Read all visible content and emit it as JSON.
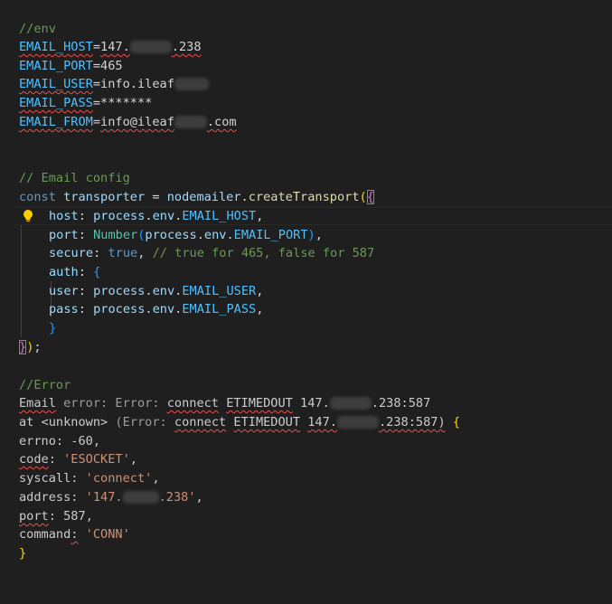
{
  "env_block": {
    "comment": "//env",
    "host_key": "EMAIL_HOST",
    "host_prefix": "147.",
    "host_suffix": ".238",
    "port_key": "EMAIL_PORT",
    "port_value": "465",
    "user_key": "EMAIL_USER",
    "user_value": "info.ileaf",
    "pass_key": "EMAIL_PASS",
    "pass_value": "*******",
    "from_key": "EMAIL_FROM",
    "from_prefix": "info@ileaf",
    "from_suffix": ".com"
  },
  "config_block": {
    "comment": "// Email config",
    "const_kw": "const",
    "transporter": "transporter",
    "nodemailer": "nodemailer",
    "create_fn": "createTransport",
    "host_prop": "host",
    "process": "process",
    "env": "env",
    "email_host": "EMAIL_HOST",
    "port_prop": "port",
    "number_fn": "Number",
    "email_port": "EMAIL_PORT",
    "secure_prop": "secure",
    "true_kw": "true",
    "secure_comment": "// true for 465, false for 587",
    "auth_prop": "auth",
    "user_prop": "user",
    "email_user": "EMAIL_USER",
    "pass_prop": "pass",
    "email_pass": "EMAIL_PASS"
  },
  "error_block": {
    "comment": "//Error",
    "email_word": "Email",
    "error_label": "error: Error:",
    "connect": "connect",
    "etimedout": "ETIMEDOUT",
    "ip_prefix": "147.",
    "ip_suffix": ".238:587",
    "at_word": "at",
    "unknown": "<unknown>",
    "error_open": "(Error:",
    "ip2_suffix": ".238:587)",
    "errno_key": "errno",
    "errno_val": "-60",
    "code_key": "code",
    "code_val": "'ESOCKET'",
    "syscall_key": "syscall",
    "syscall_val": "'connect'",
    "address_key": "address",
    "address_prefix": "'147.",
    "address_suffix": ".238'",
    "port_key": "port",
    "port_val": "587",
    "command_key": "command",
    "command_val": "'CONN'"
  },
  "colors": {
    "background": "#1f1f1f",
    "comment": "#6a9955",
    "constant": "#4fc1ff",
    "keyword": "#569cd6",
    "string": "#ce9178",
    "error_squiggle": "#f14c4c"
  },
  "icons": {
    "lightbulb": "lightbulb-icon"
  }
}
